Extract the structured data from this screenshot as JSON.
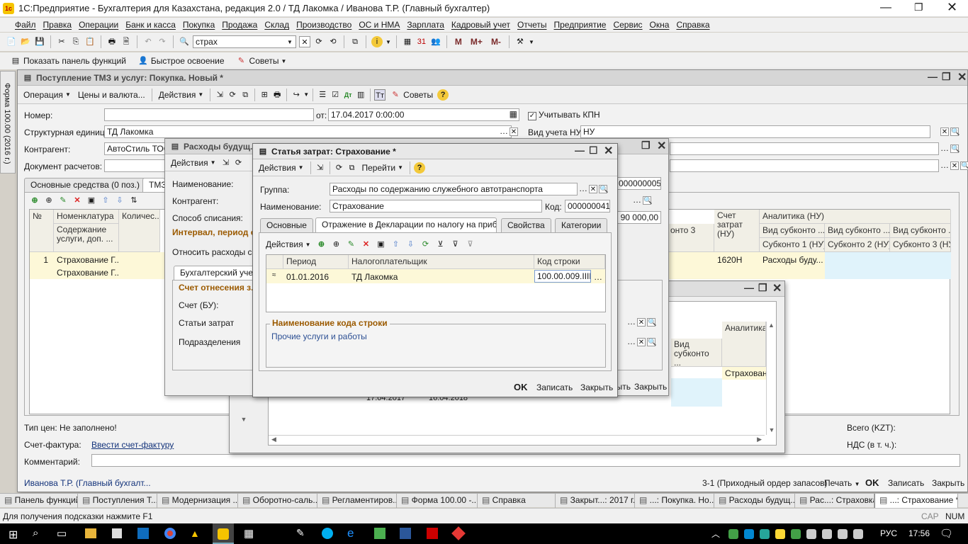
{
  "app": {
    "title": "1С:Предприятие - Бухгалтерия для Казахстана, редакция 2.0 / ТД Лакомка / Иванова Т.Р. (Главный бухгалтер)",
    "logo": "1c"
  },
  "menu": [
    "Файл",
    "Правка",
    "Операции",
    "Банк и касса",
    "Покупка",
    "Продажа",
    "Склад",
    "Производство",
    "ОС и НМА",
    "Зарплата",
    "Кадровый учет",
    "Отчеты",
    "Предприятие",
    "Сервис",
    "Окна",
    "Справка"
  ],
  "toolbar": {
    "search_value": "страх",
    "m1": "M",
    "m2": "M+",
    "m3": "M-"
  },
  "toolbar2": {
    "show_panel": "Показать панель функций",
    "quick": "Быстрое освоение",
    "tips": "Советы"
  },
  "side_tab": "Форма 100.00 (2016 г.)",
  "main": {
    "title": "Поступление ТМЗ и услуг: Покупка. Новый *",
    "tb": {
      "operation": "Операция",
      "prices": "Цены и валюта...",
      "actions": "Действия",
      "tips": "Советы"
    },
    "number_label": "Номер:",
    "number_value": "",
    "from_label": "от:",
    "date_value": "17.04.2017  0:00:00",
    "kpn_label": "Учитывать КПН",
    "unit_label": "Структурная единица:",
    "unit_value": "ТД Лакомка",
    "nu_label": "Вид учета НУ:",
    "nu_value": "НУ",
    "contragent_label": "Контрагент:",
    "contragent_value": "АвтоСтиль ТОО",
    "doc_label": "Документ расчетов:",
    "tabs": [
      "Основные средства (0 поз.)",
      "ТМЗ"
    ],
    "cols": {
      "num": "№",
      "nom": "Номенклатура",
      "qty": "Количес...",
      "content": "Содержание услуги, доп. ...",
      "account": "Счет затрат (НУ)",
      "analytics": "Аналитика (НУ)",
      "sub1": "Вид субконто ...",
      "sub2": "Вид субконто ...",
      "sub3": "Вид субконто ...",
      "s1": "Субконто 1 (НУ)",
      "s2": "Субконто 2 (НУ)",
      "s3": "Субконто 3 (НУ)",
      "c3": "онто 3"
    },
    "row": {
      "n": "1",
      "nom": "Страхование Г...",
      "content": "Страхование Г...",
      "acc": "1620Н",
      "an": "Расходы буду..."
    },
    "price_type": "Тип цен: Не заполнено!",
    "invoice_label": "Счет-фактура:",
    "invoice_link": "Ввести счет-фактуру",
    "comment_label": "Комментарий:",
    "total_label": "Всего (KZT):",
    "vat_label": "НДС (в т. ч.):",
    "user": "Иванова Т.Р. (Главный бухгалт...",
    "order": "3-1 (Приходный ордер запасов)",
    "print": "Печать",
    "ok": "OK",
    "save": "Записать",
    "close": "Закрыть"
  },
  "future": {
    "title": "Расходы будущ...",
    "actions": "Действия",
    "name_label": "Наименование:",
    "contr_label": "Контрагент:",
    "method_label": "Способ списания:",
    "interval": "Интервал, период с...",
    "from": "Относить расходы с:",
    "acc_tab": "Бухгалтерский учет",
    "acc_heading": "Счет отнесения з...",
    "acc_bu": "Счет (БУ):",
    "cost": "Статьи затрат",
    "div": "Подразделения",
    "code_tail": "000000005",
    "sum_tail": "90 000,00"
  },
  "back": {
    "analytics": "Аналитика",
    "kind": "Вид субконто ...",
    "cell": "Страхован",
    "d1": "17.04.2017",
    "d2": "16.04.2018",
    "close1": "рыть",
    "close2": "Закрыть"
  },
  "dialog": {
    "title": "Статья затрат: Страхование *",
    "actions": "Действия",
    "goto": "Перейти",
    "group_label": "Группа:",
    "group_value": "Расходы по содержанию служебного автотранспорта",
    "name_label": "Наименование:",
    "name_value": "Страхование",
    "code_label": "Код:",
    "code_value": "000000041",
    "tabs": [
      "Основные",
      "Отражение в Декларации по налогу на приб...",
      "Свойства",
      "Категории"
    ],
    "grid_actions": "Действия",
    "cols": [
      "Период",
      "Налогоплательщик",
      "Код строки"
    ],
    "row": {
      "period": "01.01.2016",
      "payer": "ТД Лакомка",
      "code": "100.00.009.IIIH"
    },
    "group_box": "Наименование кода строки",
    "code_name": "Прочие услуги и работы",
    "ok": "OK",
    "save": "Записать",
    "close": "Закрыть"
  },
  "taskbar": [
    "Панель функций",
    "Поступления Т...",
    "Модернизация ...",
    "Оборотно-саль...",
    "Регламентиров...",
    "Форма 100.00 -...",
    "Справка",
    "Закрыт...: 2017 г.",
    "...: Покупка. Но...",
    "Расходы будущ...",
    "Рас...: Страховка",
    "...: Страхование *"
  ],
  "status": {
    "hint": "Для получения подсказки нажмите F1",
    "caps": "CAP",
    "num": "NUM"
  },
  "win_taskbar": {
    "lang": "РУС",
    "time": "17:56"
  }
}
